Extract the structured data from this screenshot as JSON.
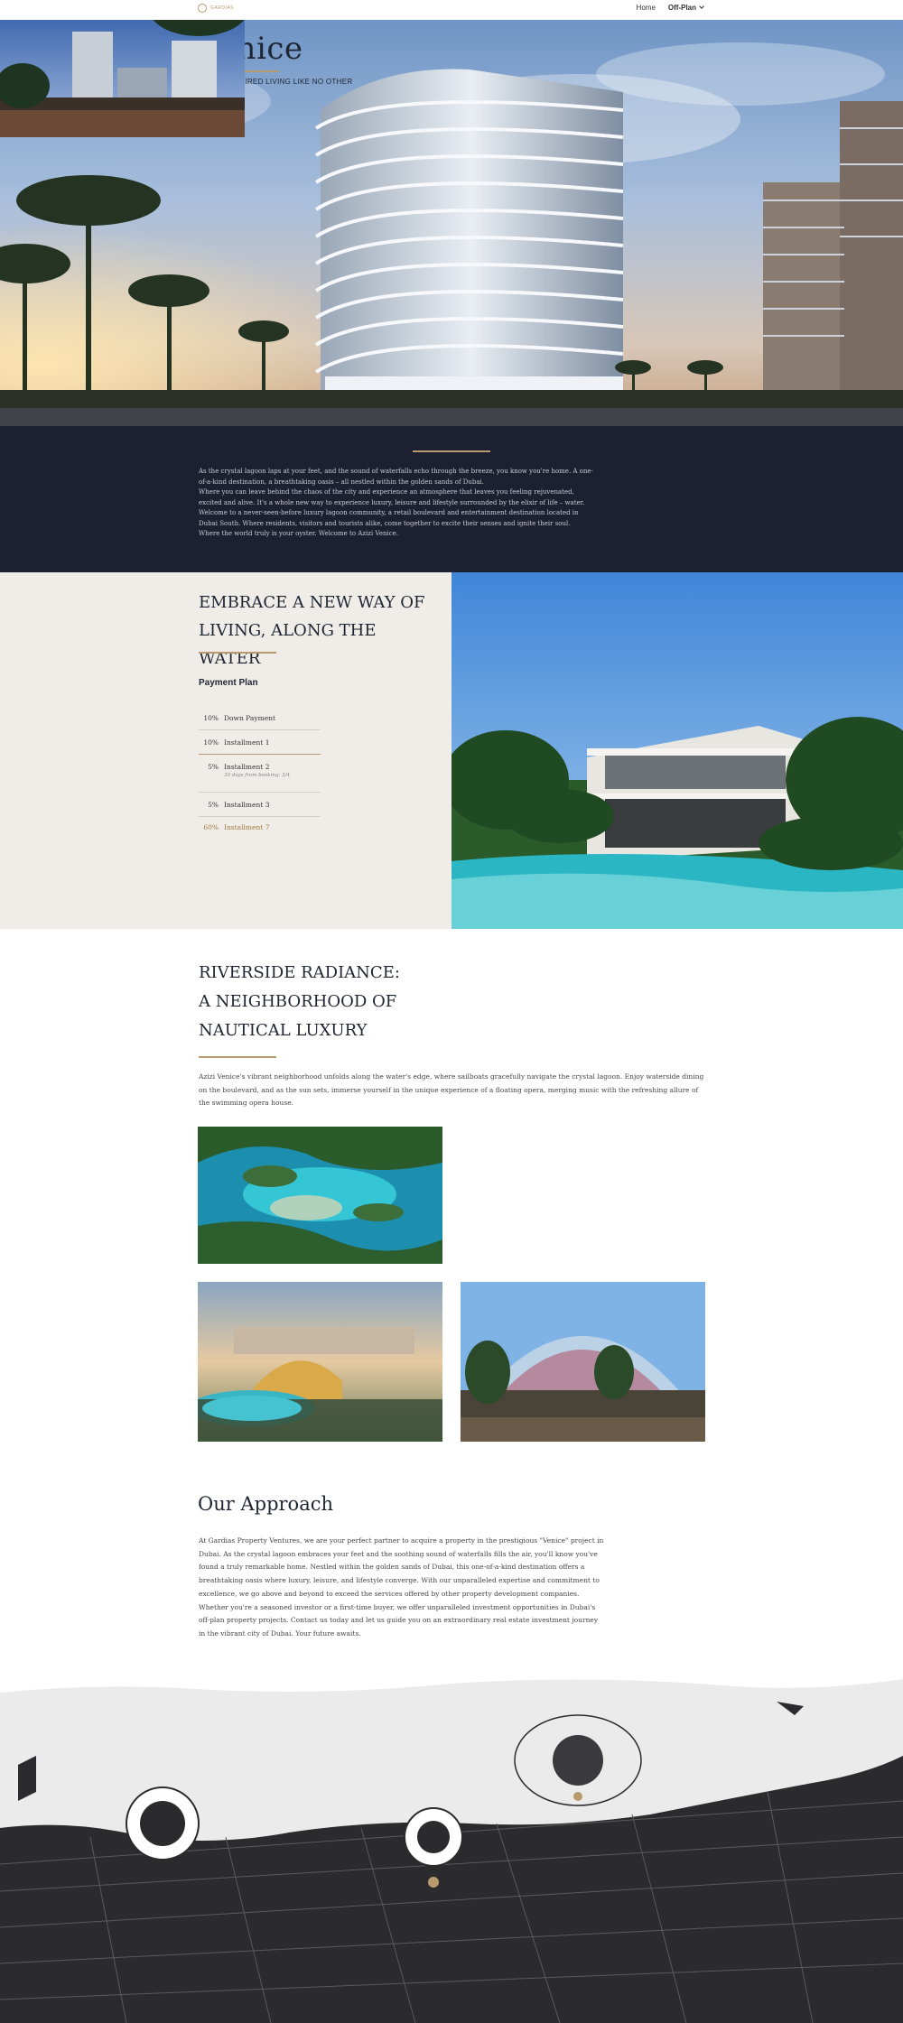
{
  "nav": {
    "logo_text": "GARDIAS",
    "items": [
      {
        "label": "Home"
      },
      {
        "label": "Off-Plan"
      }
    ]
  },
  "hero": {
    "title": "Venice",
    "subtitle": "WATER-INSPIRED LIVING LIKE NO OTHER"
  },
  "intro": {
    "paragraphs": [
      "As the crystal lagoon laps at your feet, and the sound of waterfalls echo through the breeze, you know you're home. A one-of-a-kind destination, a breathtaking oasis – all nestled within the golden sands of Dubai.",
      "Where you can leave behind the chaos of the city and experience an atmosphere that leaves you feeling rejuvenated, excited and alive. It's a whole new way to experience luxury, leisure and lifestyle surrounded by the elixir of life – water.",
      "Welcome to a never-seen-before luxury lagoon community, a retail boulevard and entertainment destination located in Dubai South. Where residents, visitors and tourists alike, come together to excite their senses and ignite their soul.",
      "Where the world truly is your oyster. Welcome to Azizi Venice."
    ]
  },
  "plan": {
    "title_line1": "EMBRACE A NEW WAY OF",
    "title_line2": "LIVING, ALONG THE WATER",
    "subtitle": "Payment Plan",
    "rows": [
      {
        "pct": "10%",
        "label": "Down Payment",
        "note": ""
      },
      {
        "pct": "10%",
        "label": "Installment 1",
        "note": ""
      },
      {
        "pct": "5%",
        "label": "Installment 2",
        "note": "30 days from booking: 3/4"
      },
      {
        "pct": "5%",
        "label": "Installment 3",
        "note": ""
      },
      {
        "pct": "60%",
        "label": "Installment 7",
        "note": ""
      }
    ]
  },
  "riverside": {
    "title_line1": "RIVERSIDE RADIANCE:",
    "title_line2": "A NEIGHBORHOOD OF",
    "title_line3": "NAUTICAL LUXURY",
    "text": "Azizi Venice's vibrant neighborhood unfolds along the water's edge, where sailboats gracefully navigate the crystal lagoon. Enjoy waterside dining on the boulevard, and as the sun sets, immerse yourself in the unique experience of a floating opera, merging music with the refreshing allure of the swimming opera house."
  },
  "approach": {
    "title": "Our Approach",
    "text": "At Gardias Property Ventures, we are your perfect partner to acquire a property in the prestigious \"Venice\" project in Dubai. As the crystal lagoon embraces your feet and the soothing sound of waterfalls fills the air, you'll know you've found a truly remarkable home. Nestled within the golden sands of Dubai, this one-of-a-kind destination offers a breathtaking oasis where luxury, leisure, and lifestyle converge. With our unparalleled expertise and commitment to excellence, we go above and beyond to exceed the services offered by other property development companies. Whether you're a seasoned investor or a first-time buyer, we offer unparalleled investment opportunities in Dubai's off-plan property projects. Contact us today and let us guide you on an extraordinary real estate investment journey in the vibrant city of Dubai. Your future awaits."
  },
  "colors": {
    "accent": "#b79a6e",
    "dark_band": "#1c2030",
    "beige_panel": "#f0ede8",
    "heading": "#1f2633"
  }
}
